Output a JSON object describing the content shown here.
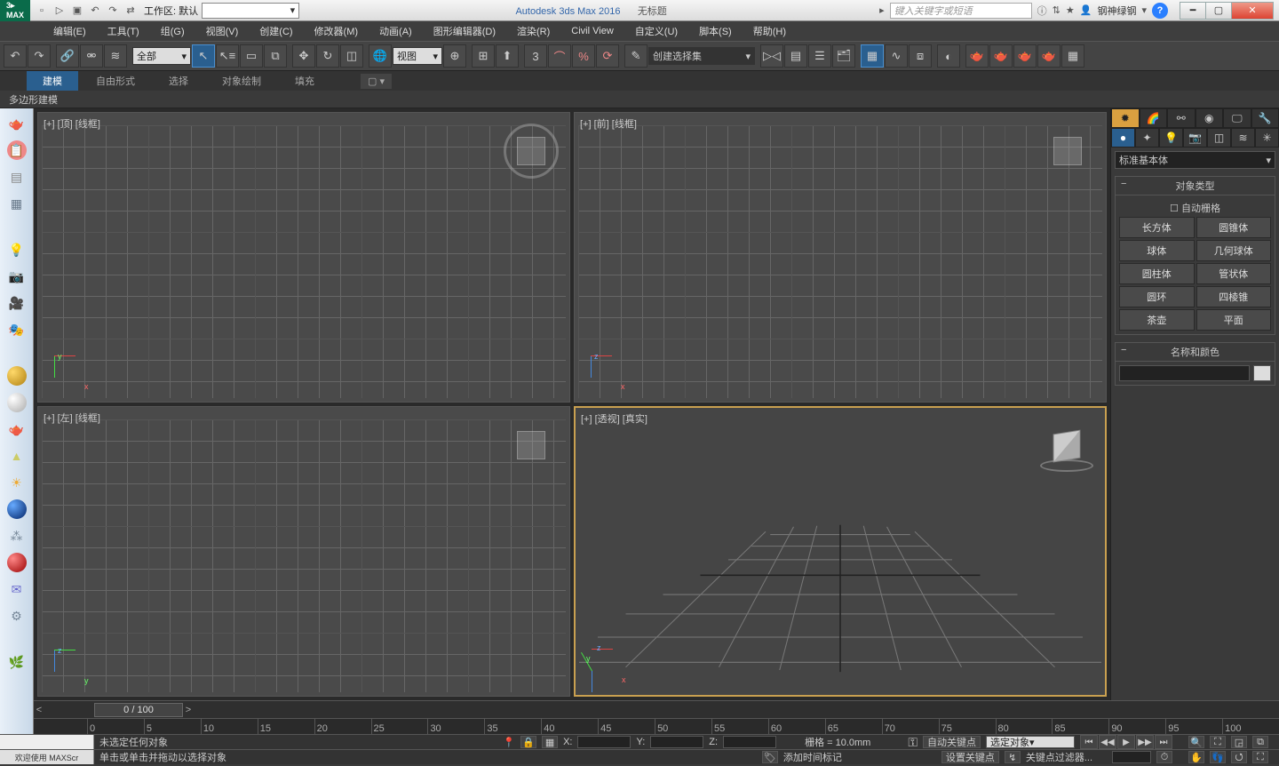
{
  "title": {
    "app": "Autodesk 3ds Max 2016",
    "document": "无标题",
    "workspace_label": "工作区: 默认",
    "search_placeholder": "键入关键字或短语",
    "user": "钢神绿钢"
  },
  "menus": [
    "编辑(E)",
    "工具(T)",
    "组(G)",
    "视图(V)",
    "创建(C)",
    "修改器(M)",
    "动画(A)",
    "图形编辑器(D)",
    "渲染(R)",
    "Civil View",
    "自定义(U)",
    "脚本(S)",
    "帮助(H)"
  ],
  "toolbar": {
    "filter_all": "全部",
    "ref_frame": "视图",
    "named_set": "创建选择集"
  },
  "ribbon": {
    "tabs": [
      "建模",
      "自由形式",
      "选择",
      "对象绘制",
      "填充"
    ],
    "active": 0,
    "sub_label": "多边形建模"
  },
  "viewports": {
    "top": "[+] [顶] [线框]",
    "front": "[+] [前] [线框]",
    "left": "[+] [左] [线框]",
    "persp": "[+] [透视] [真实]"
  },
  "cmd": {
    "category": "标准基本体",
    "rollout_object_type": "对象类型",
    "auto_grid": "自动栅格",
    "primitives": [
      "长方体",
      "圆锥体",
      "球体",
      "几何球体",
      "圆柱体",
      "管状体",
      "圆环",
      "四棱锥",
      "茶壶",
      "平面"
    ],
    "rollout_name_color": "名称和颜色"
  },
  "timeline": {
    "slider": "0 / 100",
    "ticks": [
      "0",
      "5",
      "10",
      "15",
      "20",
      "25",
      "30",
      "35",
      "40",
      "45",
      "50",
      "55",
      "60",
      "65",
      "70",
      "75",
      "80",
      "85",
      "90",
      "95",
      "100"
    ]
  },
  "status": {
    "line1_left": "",
    "no_selection": "未选定任何对象",
    "x": "X:",
    "y": "Y:",
    "z": "Z:",
    "grid": "栅格 = 10.0mm",
    "auto_key": "自动关键点",
    "selected_obj": "选定对象",
    "line2_left": "欢迎使用  MAXScr",
    "hint": "单击或单击并拖动以选择对象",
    "add_time_tag": "添加时间标记",
    "set_key": "设置关键点",
    "key_filter": "关键点过滤器..."
  }
}
